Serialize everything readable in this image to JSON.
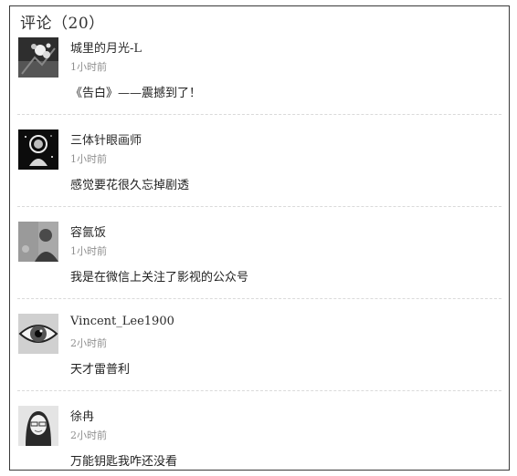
{
  "section": {
    "title": "评论（20）"
  },
  "comments": [
    {
      "user": "城里的月光-L",
      "time": "1小时前",
      "text": "《告白》——震撼到了！",
      "avatar_icon": "blossom-avatar-icon"
    },
    {
      "user": "三体针眼画师",
      "time": "1小时前",
      "text": "感觉要花很久忘掉剧透",
      "avatar_icon": "astronaut-avatar-icon"
    },
    {
      "user": "容氤饭",
      "time": "1小时前",
      "text": "我是在微信上关注了影视的公众号",
      "avatar_icon": "portrait-avatar-icon"
    },
    {
      "user": "Vincent_Lee1900",
      "time": "2小时前",
      "text": "天才雷普利",
      "avatar_icon": "eye-avatar-icon"
    },
    {
      "user": "徐冉",
      "time": "2小时前",
      "text": "万能钥匙我咋还没看",
      "avatar_icon": "girl-avatar-icon"
    }
  ]
}
